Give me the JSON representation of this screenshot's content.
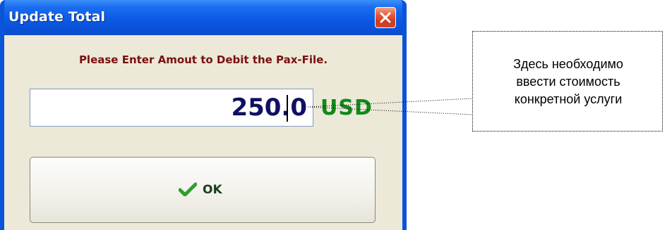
{
  "dialog": {
    "title": "Update Total",
    "close_icon": "close-icon",
    "prompt": "Please Enter Amout to Debit the Pax-File.",
    "amount_value": "250.0",
    "currency": "USD",
    "ok_label": "OK",
    "ok_icon": "checkmark-icon"
  },
  "callout": {
    "lines": [
      "Здесь необходимо",
      "ввести стоимость",
      "конкретной услуги"
    ]
  },
  "colors": {
    "titlebar": "#0a54d8",
    "prompt": "#7a1010",
    "amount": "#101063",
    "currency": "#13891b",
    "checkmark": "#2e9e2e",
    "close": "#d23b1d"
  }
}
